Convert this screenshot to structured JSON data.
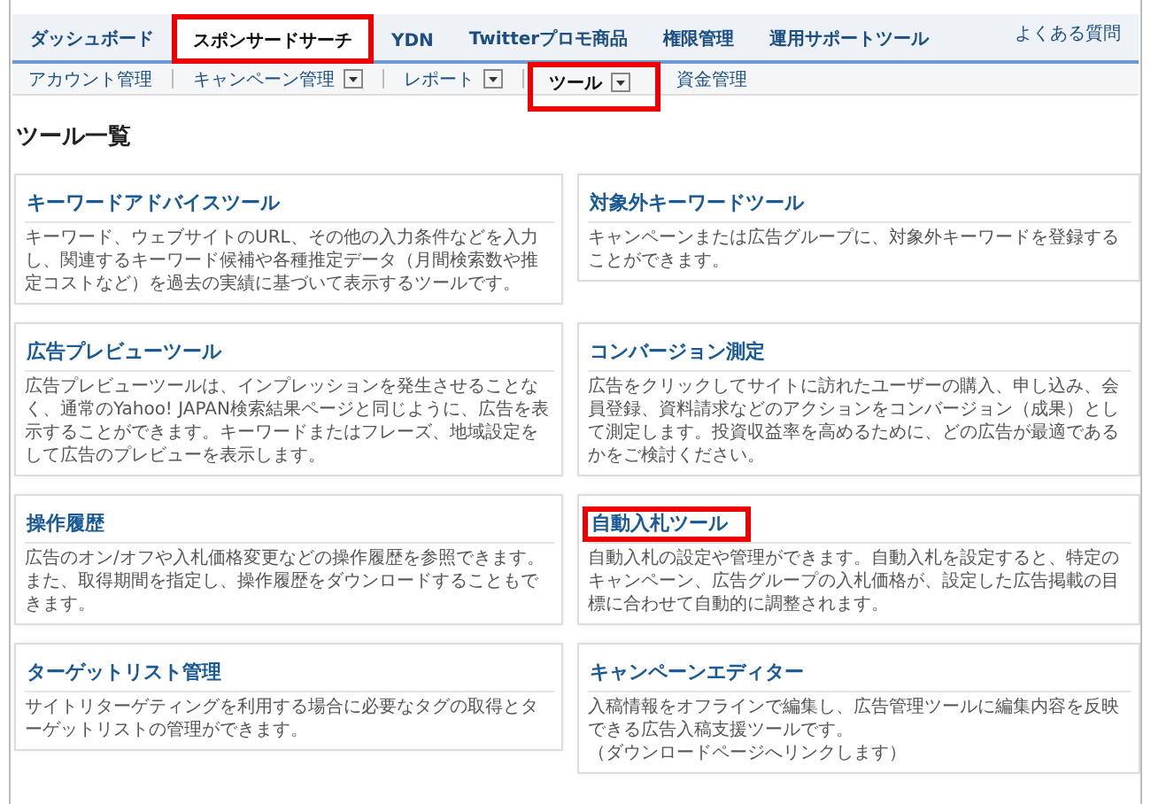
{
  "tabs": [
    {
      "label": "ダッシュボード",
      "selected": false,
      "highlighted": false
    },
    {
      "label": "スポンサードサーチ",
      "selected": true,
      "highlighted": true
    },
    {
      "label": "YDN",
      "selected": false,
      "highlighted": false
    },
    {
      "label": "Twitterプロモ商品",
      "selected": false,
      "highlighted": false
    },
    {
      "label": "権限管理",
      "selected": false,
      "highlighted": false
    },
    {
      "label": "運用サポートツール",
      "selected": false,
      "highlighted": false
    }
  ],
  "help_link": "よくある質問",
  "subnav": [
    {
      "label": "アカウント管理",
      "dropdown": false,
      "selected": false,
      "highlighted": false
    },
    {
      "label": "キャンペーン管理",
      "dropdown": true,
      "selected": false,
      "highlighted": false
    },
    {
      "label": "レポート",
      "dropdown": true,
      "selected": false,
      "highlighted": false
    },
    {
      "label": "ツール",
      "dropdown": true,
      "selected": true,
      "highlighted": true
    },
    {
      "label": "資金管理",
      "dropdown": false,
      "selected": false,
      "highlighted": false
    }
  ],
  "page_title": "ツール一覧",
  "tools": [
    {
      "title": "キーワードアドバイスツール",
      "description": "キーワード、ウェブサイトのURL、その他の入力条件などを入力し、関連するキーワード候補や各種推定データ（月間検索数や推定コストなど）を過去の実績に基づいて表示するツールです。",
      "highlighted": false
    },
    {
      "title": "対象外キーワードツール",
      "description": "キャンペーンまたは広告グループに、対象外キーワードを登録することができます。",
      "highlighted": false
    },
    {
      "title": "広告プレビューツール",
      "description": "広告プレビューツールは、インプレッションを発生させることなく、通常のYahoo! JAPAN検索結果ページと同じように、広告を表示することができます。キーワードまたはフレーズ、地域設定をして広告のプレビューを表示します。",
      "highlighted": false
    },
    {
      "title": "コンバージョン測定",
      "description": "広告をクリックしてサイトに訪れたユーザーの購入、申し込み、会員登録、資料請求などのアクションをコンバージョン（成果）として測定します。投資収益率を高めるために、どの広告が最適であるかをご検討ください。",
      "highlighted": false
    },
    {
      "title": "操作履歴",
      "description": "広告のオン/オフや入札価格変更などの操作履歴を参照できます。また、取得期間を指定し、操作履歴をダウンロードすることもできます。",
      "highlighted": false
    },
    {
      "title": "自動入札ツール",
      "description": "自動入札の設定や管理ができます。自動入札を設定すると、特定のキャンペーン、広告グループの入札価格が、設定した広告掲載の目標に合わせて自動的に調整されます。",
      "highlighted": true
    },
    {
      "title": "ターゲットリスト管理",
      "description": "サイトリターゲティングを利用する場合に必要なタグの取得とターゲットリストの管理ができます。",
      "highlighted": false
    },
    {
      "title": "キャンペーンエディター",
      "description": "入稿情報をオフラインで編集し、広告管理ツールに編集内容を反映できる広告入稿支援ツールです。",
      "note": "（ダウンロードページへリンクします）",
      "highlighted": false
    }
  ]
}
